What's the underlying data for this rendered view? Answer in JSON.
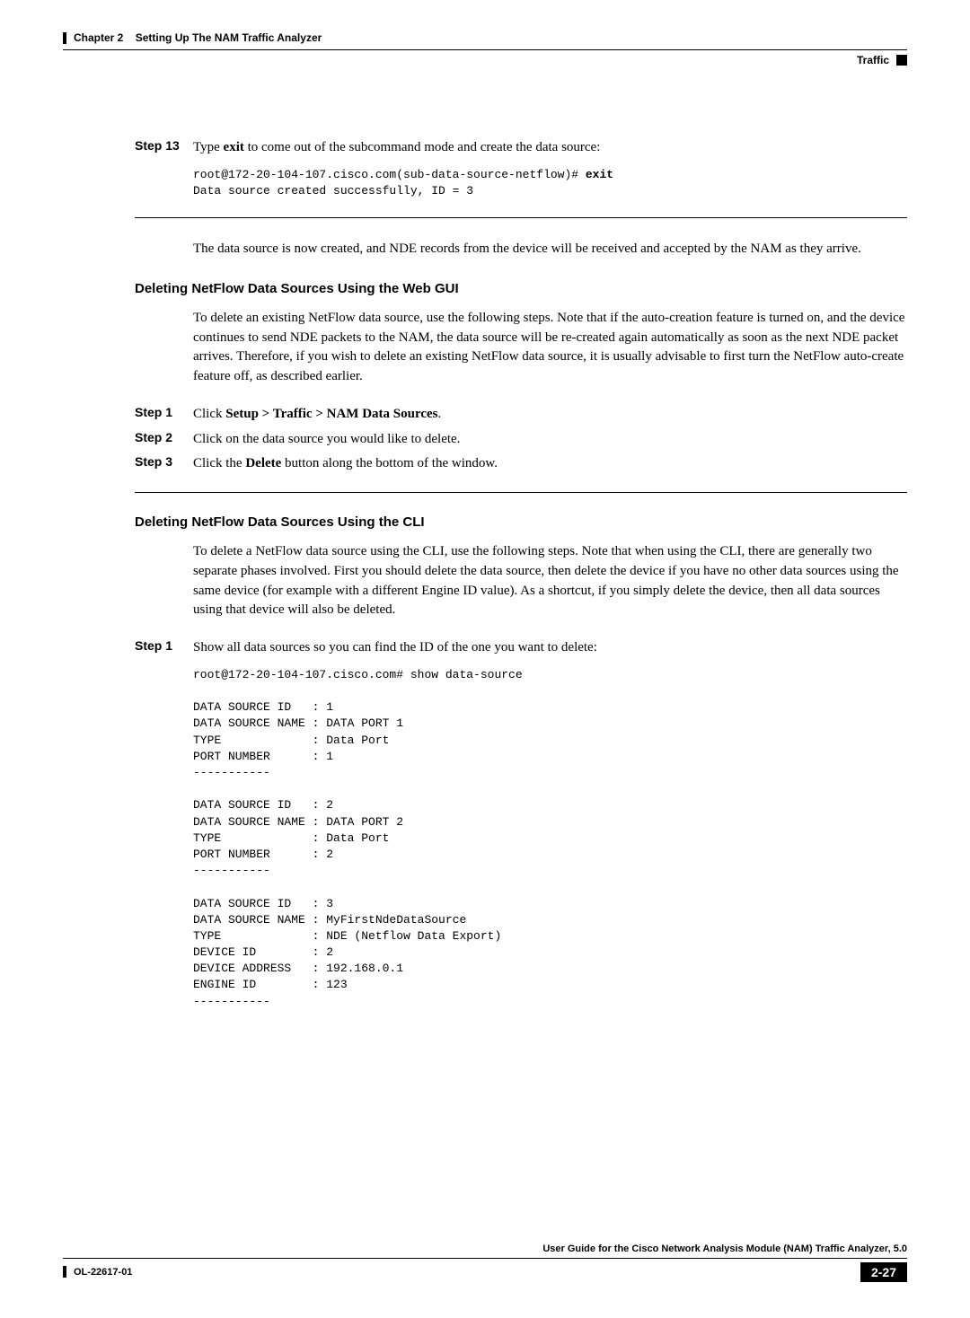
{
  "header": {
    "chapter_label": "Chapter 2",
    "chapter_title": "Setting Up The NAM Traffic Analyzer",
    "section": "Traffic"
  },
  "step13": {
    "label": "Step 13",
    "text_before": "Type ",
    "bold_cmd": "exit",
    "text_after": " to come out of the subcommand mode and create the data source:",
    "code_prompt": "root@172-20-104-107.cisco.com(sub-data-source-netflow)# ",
    "code_cmd": "exit",
    "code_line2": "Data source created successfully, ID = 3"
  },
  "para_after_step13": "The data source is now created, and NDE records from the device will be received and accepted by the NAM as they arrive.",
  "section1": {
    "heading": "Deleting NetFlow Data Sources Using the Web GUI",
    "intro": "To delete an existing NetFlow data source, use the following steps.  Note that if the auto-creation feature is turned on, and the device continues to send NDE packets to the NAM, the data source will be re-created again automatically as soon as the next NDE packet arrives.  Therefore, if you wish to delete an existing NetFlow data source, it is usually advisable to first turn the NetFlow auto-create feature off, as described earlier.",
    "steps": {
      "s1": {
        "label": "Step 1",
        "pre": "Click ",
        "bold": "Setup > Traffic > NAM Data Sources",
        "post": "."
      },
      "s2": {
        "label": "Step 2",
        "text": "Click on the data source you would like to delete."
      },
      "s3": {
        "label": "Step 3",
        "pre": "Click the ",
        "bold": "Delete",
        "post": " button along the bottom of the window."
      }
    }
  },
  "section2": {
    "heading": "Deleting NetFlow Data Sources Using the CLI",
    "intro": "To delete a NetFlow data source using the CLI, use the following steps.  Note that when using the CLI, there are generally two separate phases involved.  First you should delete the data source, then delete the device if you have no other data sources using the same device (for example with a different Engine ID value).  As a shortcut, if you simply delete the device, then all data sources using that device will also be deleted.",
    "step1": {
      "label": "Step 1",
      "text": "Show all data sources so you can find the ID of the one you want to delete:",
      "code": "root@172-20-104-107.cisco.com# show data-source\n\nDATA SOURCE ID   : 1\nDATA SOURCE NAME : DATA PORT 1\nTYPE             : Data Port\nPORT NUMBER      : 1\n-----------\n\nDATA SOURCE ID   : 2\nDATA SOURCE NAME : DATA PORT 2\nTYPE             : Data Port\nPORT NUMBER      : 2\n-----------\n\nDATA SOURCE ID   : 3\nDATA SOURCE NAME : MyFirstNdeDataSource\nTYPE             : NDE (Netflow Data Export)\nDEVICE ID        : 2\nDEVICE ADDRESS   : 192.168.0.1\nENGINE ID        : 123\n-----------"
    }
  },
  "footer": {
    "guide_title": "User Guide for the Cisco Network Analysis Module (NAM) Traffic Analyzer, 5.0",
    "doc_id": "OL-22617-01",
    "page_number": "2-27"
  }
}
